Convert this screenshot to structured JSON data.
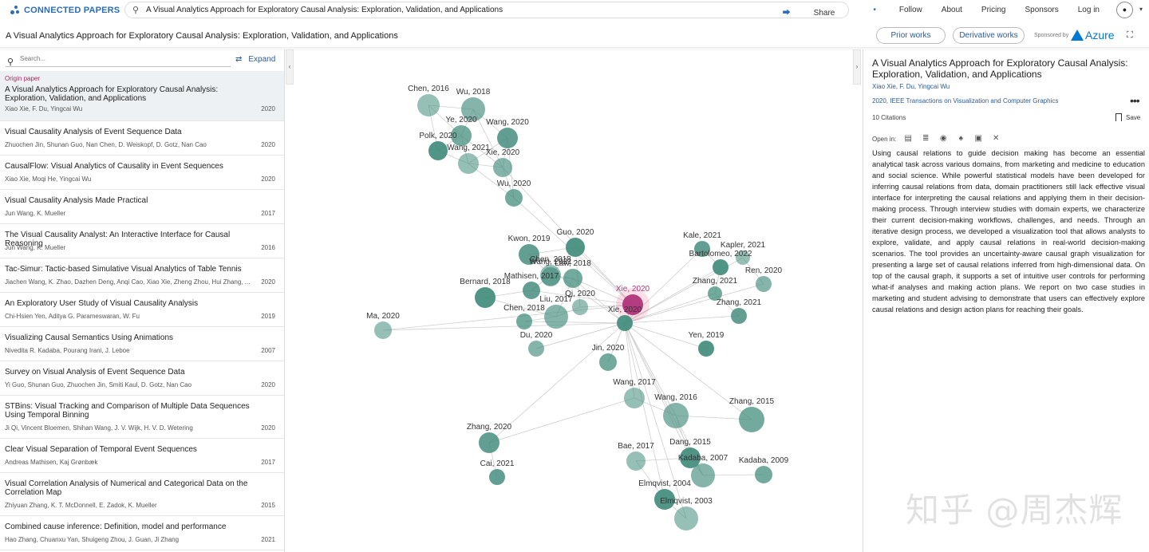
{
  "topbar": {
    "brand": "CONNECTED PAPERS",
    "search_value": "A Visual Analytics Approach for Exploratory Causal Analysis: Exploration, Validation, and Applications",
    "share": "Share",
    "follow": "Follow",
    "about": "About",
    "pricing": "Pricing",
    "sponsors": "Sponsors",
    "login": "Log in"
  },
  "subbar": {
    "title": "A Visual Analytics Approach for Exploratory Causal Analysis: Exploration, Validation, and Applications",
    "prior_works": "Prior works",
    "derivative_works": "Derivative works",
    "sponsored_by": "Sponsored by",
    "sponsor_name": "Azure"
  },
  "left": {
    "search_placeholder": "Search...",
    "expand": "Expand",
    "origin_label": "Origin paper",
    "papers": [
      {
        "title": "A Visual Analytics Approach for Exploratory Causal Analysis: Exploration, Validation, and Applications",
        "authors": "Xiao Xie, F. Du, Yingcai Wu",
        "year": "2020"
      },
      {
        "title": "Visual Causality Analysis of Event Sequence Data",
        "authors": "Zhuochen Jin, Shunan Guo, Nan Chen, D. Weiskopf, D. Gotz, Nan Cao",
        "year": "2020"
      },
      {
        "title": "CausalFlow: Visual Analytics of Causality in Event Sequences",
        "authors": "Xiao Xie, Moqi He, Yingcai Wu",
        "year": "2020"
      },
      {
        "title": "Visual Causality Analysis Made Practical",
        "authors": "Jun Wang, K. Mueller",
        "year": "2017"
      },
      {
        "title": "The Visual Causality Analyst: An Interactive Interface for Causal Reasoning",
        "authors": "Jun Wang, K. Mueller",
        "year": "2016"
      },
      {
        "title": "Tac-Simur: Tactic-based Simulative Visual Analytics of Table Tennis",
        "authors": "Jiachen Wang, K. Zhao, Dazhen Deng, Anqi Cao, Xiao Xie, Zheng Zhou, Hui Zhang, ...",
        "year": "2020"
      },
      {
        "title": "An Exploratory User Study of Visual Causality Analysis",
        "authors": "Chi-Hsien Yen, Aditya G. Parameswaran, W. Fu",
        "year": "2019"
      },
      {
        "title": "Visualizing Causal Semantics Using Animations",
        "authors": "Nivedita R. Kadaba, Pourang Irani, J. Leboe",
        "year": "2007"
      },
      {
        "title": "Survey on Visual Analysis of Event Sequence Data",
        "authors": "Yi Guo, Shunan Guo, Zhuochen Jin, Smiti Kaul, D. Gotz, Nan Cao",
        "year": "2020"
      },
      {
        "title": "STBins: Visual Tracking and Comparison of Multiple Data Sequences Using Temporal Binning",
        "authors": "Ji Qi, Vincent Bloemen, Shihan Wang, J. V. Wijk, H. V. D. Wetering",
        "year": "2020"
      },
      {
        "title": "Clear Visual Separation of Temporal Event Sequences",
        "authors": "Andreas Mathisen, Kaj Grønbæk",
        "year": "2017"
      },
      {
        "title": "Visual Correlation Analysis of Numerical and Categorical Data on the Correlation Map",
        "authors": "Zhiyuan Zhang, K. T. McDonnell, E. Zadok, K. Mueller",
        "year": "2015"
      },
      {
        "title": "Combined cause inference: Definition, model and performance",
        "authors": "Hao Zhang, Chuanxu Yan, Shuigeng Zhou, J. Guan, Ji Zhang",
        "year": "2021"
      }
    ]
  },
  "graph": {
    "nodes": [
      {
        "label": "Chen, 2016",
        "highlight": false
      },
      {
        "label": "Wu, 2018",
        "highlight": false
      },
      {
        "label": "Ye, 2020",
        "highlight": false
      },
      {
        "label": "Wang, 2020",
        "highlight": false
      },
      {
        "label": "Polk, 2020",
        "highlight": false
      },
      {
        "label": "Wang, 2021",
        "highlight": false
      },
      {
        "label": "Xie, 2020",
        "highlight": false
      },
      {
        "label": "Wu, 2020",
        "highlight": false
      },
      {
        "label": "Kwon, 2019",
        "highlight": false
      },
      {
        "label": "Guo, 2020",
        "highlight": false
      },
      {
        "label": "Chen, 2018",
        "highlight": false
      },
      {
        "label": "Wang, 2021",
        "highlight": false
      },
      {
        "label": "Law, 2018",
        "highlight": false
      },
      {
        "label": "Mathisen, 2017",
        "highlight": false
      },
      {
        "label": "Bernard, 2018",
        "highlight": false
      },
      {
        "label": "Qi, 2020",
        "highlight": false
      },
      {
        "label": "Liu, 2017",
        "highlight": false
      },
      {
        "label": "Chen, 2018",
        "highlight": false
      },
      {
        "label": "Xie, 2020",
        "highlight": true
      },
      {
        "label": "Xie, 2020",
        "highlight": false
      },
      {
        "label": "Ma, 2020",
        "highlight": false
      },
      {
        "label": "Du, 2020",
        "highlight": false
      },
      {
        "label": "Jin, 2020",
        "highlight": false
      },
      {
        "label": "Kale, 2021",
        "highlight": false
      },
      {
        "label": "Bartolomeo, 2022",
        "highlight": false
      },
      {
        "label": "Kapler, 2021",
        "highlight": false
      },
      {
        "label": "Ren, 2020",
        "highlight": false
      },
      {
        "label": "Zhang, 2021",
        "highlight": false
      },
      {
        "label": "Zhang, 2021",
        "highlight": false
      },
      {
        "label": "Yen, 2019",
        "highlight": false
      },
      {
        "label": "Wang, 2017",
        "highlight": false
      },
      {
        "label": "Wang, 2016",
        "highlight": false
      },
      {
        "label": "Zhang, 2015",
        "highlight": false
      },
      {
        "label": "Zhang, 2020",
        "highlight": false
      },
      {
        "label": "Dang, 2015",
        "highlight": false
      },
      {
        "label": "Bae, 2017",
        "highlight": false
      },
      {
        "label": "Kadaba, 2007",
        "highlight": false
      },
      {
        "label": "Kadaba, 2009",
        "highlight": false
      },
      {
        "label": "Cai, 2021",
        "highlight": false
      },
      {
        "label": "Elmqvist, 2004",
        "highlight": false
      },
      {
        "label": "Elmqvist, 2003",
        "highlight": false
      }
    ]
  },
  "right": {
    "title": "A Visual Analytics Approach for Exploratory Causal Analysis: Exploration, Validation, and Applications",
    "authors": "Xiao Xie, F. Du, Yingcai Wu",
    "venue": "2020, IEEE Transactions on Visualization and Computer Graphics",
    "citations": "10 Citations",
    "save": "Save",
    "open_in": "Open in:",
    "abstract": "Using causal relations to guide decision making has become an essential analytical task across various domains, from marketing and medicine to education and social science. While powerful statistical models have been developed for inferring causal relations from data, domain practitioners still lack effective visual interface for interpreting the causal relations and applying them in their decision-making process. Through interview studies with domain experts, we characterize their current decision-making workflows, challenges, and needs. Through an iterative design process, we developed a visualization tool that allows analysts to explore, validate, and apply causal relations in real-world decision-making scenarios. The tool provides an uncertainty-aware causal graph visualization for presenting a large set of causal relations inferred from high-dimensional data. On top of the causal graph, it supports a set of intuitive user controls for performing what-if analyses and making action plans. We report on two case studies in marketing and student advising to demonstrate that users can effectively explore causal relations and design action plans for reaching their goals."
  },
  "watermark": "知乎 @周杰辉",
  "colors": {
    "brand": "#2b6cb8",
    "node": "#3f8a7a",
    "highlight": "#b0337a",
    "origin_label": "#b5225f"
  }
}
